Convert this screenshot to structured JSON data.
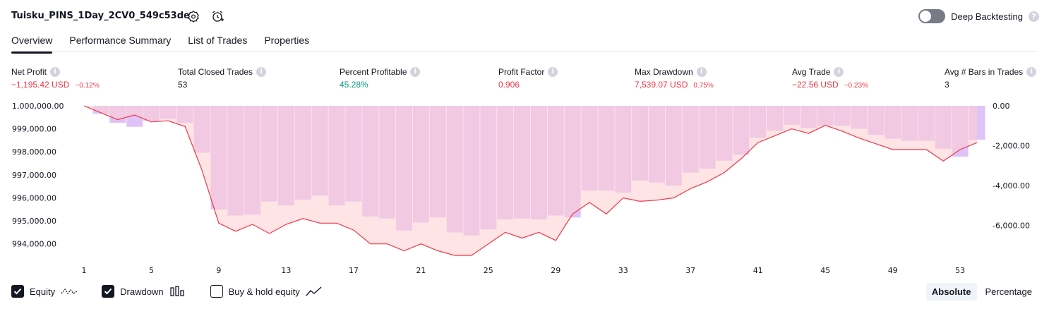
{
  "header": {
    "title": "Tuisku_PINS_1Day_2CV0_549c53de",
    "deep_backtesting_label": "Deep Backtesting",
    "deep_backtesting_enabled": false
  },
  "tabs": [
    {
      "label": "Overview",
      "active": true
    },
    {
      "label": "Performance Summary",
      "active": false
    },
    {
      "label": "List of Trades",
      "active": false
    },
    {
      "label": "Properties",
      "active": false
    }
  ],
  "metrics": {
    "net_profit": {
      "label": "Net Profit",
      "value": "−1,195.42 USD",
      "pct": "−0.12%"
    },
    "total_closed_trades": {
      "label": "Total Closed Trades",
      "value": "53"
    },
    "percent_profitable": {
      "label": "Percent Profitable",
      "value": "45.28%"
    },
    "profit_factor": {
      "label": "Profit Factor",
      "value": "0.906"
    },
    "max_drawdown": {
      "label": "Max Drawdown",
      "value": "7,539.07 USD",
      "pct": "0.75%"
    },
    "avg_trade": {
      "label": "Avg Trade",
      "value": "−22.56 USD",
      "pct": "−0.23%"
    },
    "avg_bars": {
      "label": "Avg # Bars in Trades",
      "value": "3"
    }
  },
  "colors": {
    "equity_line": "#f23645",
    "equity_fill": "#ffcdd2",
    "drawdown_bar": "#d9b8f6",
    "negative": "#f23645",
    "positive": "#089981"
  },
  "chart_data": {
    "type": "area",
    "left_axis": {
      "ticks": [
        "1,000,000.00",
        "999,000.00",
        "998,000.00",
        "997,000.00",
        "996,000.00",
        "995,000.00",
        "994,000.00"
      ],
      "range": [
        993500,
        1000000
      ]
    },
    "right_axis": {
      "ticks": [
        "0.00",
        "-2,000.00",
        "-4,000.00",
        "-6,000.00"
      ],
      "range": [
        -7500,
        0
      ]
    },
    "x_ticks": [
      "1",
      "5",
      "9",
      "13",
      "17",
      "21",
      "25",
      "29",
      "33",
      "37",
      "41",
      "45",
      "49",
      "53"
    ],
    "series": [
      {
        "kind": "equity",
        "x": [
          1,
          2,
          3,
          4,
          5,
          6,
          7,
          8,
          9,
          10,
          11,
          12,
          13,
          14,
          15,
          16,
          17,
          18,
          19,
          20,
          21,
          22,
          23,
          24,
          25,
          26,
          27,
          28,
          29,
          30,
          31,
          32,
          33,
          34,
          35,
          36,
          37,
          38,
          39,
          40,
          41,
          42,
          43,
          44,
          45,
          46,
          47,
          48,
          49,
          50,
          51,
          52,
          53,
          54
        ],
        "values": [
          1000000,
          999700,
          999400,
          999600,
          999300,
          999350,
          999100,
          997200,
          994900,
          994550,
          994850,
          994450,
          994850,
          995100,
          994900,
          994900,
          994600,
          994000,
          994000,
          993700,
          994000,
          993700,
          993500,
          993500,
          994000,
          994500,
          994250,
          994500,
          994150,
          995300,
          995800,
          995300,
          996000,
          995850,
          995900,
          996000,
          996400,
          996700,
          997100,
          997700,
          998400,
          998700,
          999000,
          998800,
          999150,
          998900,
          998600,
          998350,
          998100,
          998100,
          998100,
          997600,
          998100,
          998400
        ]
      },
      {
        "kind": "drawdown",
        "x": [
          1,
          2,
          3,
          4,
          5,
          6,
          7,
          8,
          9,
          10,
          11,
          12,
          13,
          14,
          15,
          16,
          17,
          18,
          19,
          20,
          21,
          22,
          23,
          24,
          25,
          26,
          27,
          28,
          29,
          30,
          31,
          32,
          33,
          34,
          35,
          36,
          37,
          38,
          39,
          40,
          41,
          42,
          43,
          44,
          45,
          46,
          47,
          48,
          49,
          50,
          51,
          52,
          53,
          54
        ],
        "values": [
          0,
          -400,
          -850,
          -1050,
          -750,
          -650,
          -850,
          -2350,
          -5200,
          -5500,
          -5450,
          -4800,
          -5000,
          -4700,
          -4500,
          -5000,
          -4800,
          -5550,
          -5650,
          -6250,
          -5850,
          -5600,
          -6350,
          -6500,
          -6200,
          -5700,
          -5650,
          -5700,
          -5500,
          -5600,
          -4250,
          -4250,
          -4350,
          -3750,
          -3850,
          -4000,
          -3350,
          -3150,
          -2750,
          -2450,
          -1600,
          -1250,
          -950,
          -1100,
          -1000,
          -1000,
          -1150,
          -1450,
          -1650,
          -1750,
          -1750,
          -2150,
          -2550,
          -1700
        ]
      }
    ]
  },
  "legend": [
    {
      "label": "Equity",
      "checked": true
    },
    {
      "label": "Drawdown",
      "checked": true
    },
    {
      "label": "Buy & hold equity",
      "checked": false
    }
  ],
  "mode": {
    "absolute_label": "Absolute",
    "percentage_label": "Percentage",
    "active": "Absolute"
  }
}
